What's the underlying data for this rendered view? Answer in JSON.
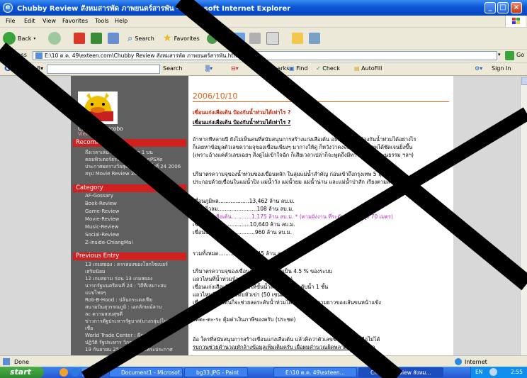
{
  "window": {
    "title": "Chubby Review สังหมสารพัด ภาพยนตร์สารพัน - Microsoft Internet Explorer",
    "controls": [
      "_",
      "□",
      "×"
    ]
  },
  "menu": [
    "File",
    "Edit",
    "View",
    "Favorites",
    "Tools",
    "Help"
  ],
  "toolbar": {
    "back": "Back",
    "search": "Search",
    "favorites": "Favorites"
  },
  "address": {
    "label": "Address",
    "value": "E:\\10 ต.ค. 49\\exteen.com\\Chubby Review สังหมสารพัด ภาพยนตร์สารพัน.htm",
    "go": "Go",
    "links": "Links"
  },
  "googlebar": {
    "logo": "Google",
    "search": "Search",
    "bookmarks": "Bookmarks",
    "find": "Find",
    "check": "Check",
    "autofill": "AutoFill",
    "signin": "Sign In"
  },
  "sidebar": {
    "profile_name": "Chubby Chocobo",
    "profile_link": "View full profile",
    "recommended_title": "Recommended",
    "recommended": [
      "ถึงเวลาเล่น Play Station 1 บน",
      "คอมพิวเตอร์ธรรมดาด้วย กับ ePSXe",
      "ประกาศผลรางวัลสุพรรณหงส์ครั้งที่ 24 2006",
      "สรุป Movie Review 2005"
    ],
    "category_title": "Category",
    "categories": [
      "AF-Gossary",
      "Book-Review",
      "Game-Review",
      "Movie-Review",
      "Music-Review",
      "Social-Review",
      "Z-Inside-ChiangMai"
    ],
    "previous_title": "Previous Entry",
    "previous": [
      "13 เกมสยอง : ดรรลองของโลกไซเบอร์",
      "เสริมนิยม",
      "12 เกมสยาม ก่อน 13 เกมสยอง",
      "นารกรัฐมนตรีคนที่ 24 : วิถีทีเหมาะสม",
      "แบบไทยๆ",
      "Rob-B-Hood : ปล้นกระเตงเฟีย",
      "สนามบินสุวรรณภูมิ : เอกลักษณ์ลาบ",
      "ละ ความสงบสุขดี",
      "ข่าวการตัฐประหารรัฐบาล(บางกลุ่ม)ไม่เคย",
      "เชื่อ",
      "World Trade Center : ผีกเงิน",
      "ปฏิวัติ รัฐประหาร วิกฤต กบฏ",
      "19 กันยายน 2549 : เมื่อทรงพระประกาศ"
    ]
  },
  "post": {
    "date": "2006/10/10",
    "title": "เขื่อนแก่งเสือเต้น ป้องกันน้ำท่วมได้เท่าไร ?",
    "subtitle": "เขื่อนแก่งเสือเต้น ป้องกันน้ำท่วมได้เท่าไร ?",
    "para1": [
      "ถ้าหากทีหลายปี ยังไม่เห็นคนที่สนับสนุนการสร้างแก่งเสือเต้น อธิบายว่ามันป้องกันน้ำท่วมได้อย่างไร",
      "ก็เลยหาข้อมูลตัวเลขความจุของเขื่อนเพียงๆ มากางให้ดู ก็หวังว่าคงจะมองเห็นภาพได้ชัดเจนยิ่งขึ้น",
      "(เพราะอ้างแค่ตัวเลขเฉยๆ สิ่งดูไม่เข้าใจฉัก ก็เสียเวลาเปล่าก็จะพูดถึงมีทาวงสังคม วัฒนธรรม ฯลฯ)"
    ],
    "para2": [
      "ปริมาตรความจุของน้ำท่วมของเขื่อนหลัก ในลุ่มแม่น้ำสำคัญ ก่อนเข้าถึงกรุงเทพ 5 ลุ่มแม่น้ำ",
      "ประกอบด้วยเขื่อนในแม่น้ำปิง แม่น้ำวัง แม่น้ำยม แม่น้ำน่าน และแม่น้ำป่าสัก เรียงตามลำดับ"
    ],
    "dams": [
      "เขื่อนภูมิพล..................13,462 ล้าน ลบ.ม.",
      "เขื่อนกิ่วลม.......................108 ล้าน ลบ.ม.",
      "เขื่อนแก่งเสือเต้น............1,175 ล้าน ลบ.ม. * (ตามผังงาน ที่ระดับสันเขื่อนสูง 70 เมตร)",
      "เขื่อนสิริกิติ์...................10,640 ล้าน ลบ.ม.",
      "เขื่อนป่าสัก......................960 ล้าน ลบ.ม."
    ],
    "total": "รวมทั้งหมด................26,345 ล้าน ลบ.ม.",
    "para3": [
      "ปริมาตรความจุของเขื่อนแก่งเสือเต้นคิดเป็น 4.5 % ของระบบ",
      "แถวไหนที่น้ำท่วมบ้านขั้นล่างเหลือ (3 เมตร)",
      "เขื่อนแก่งเสือเต้นก็จะช่วยให้ขั้นน้ำลงไปโดยมีระดับน้ำ 1 ชั้น",
      "แถวไหนที่น้ำท่วมระดับหัวเข่า (50 เซนติเมตร)",
      "เขื่อนแก่งเสือเต้นก็จะช่วยลดระดับน้ำท่วมได้เท่ากับ 1 ความยาวของเส้นขนหน้าแข้ง"
    ],
    "para4": "โคตะ-ตะ-ระ คุ้มค่าเงินภาษีของครับ (ประชด)",
    "para5": [
      "อ้อ ใครที่สนับสนุนการสร้างเขื่อนแก่งเสือเต้น แล้วคิดว่าตัวเลขข้างบนนี้เชื่อถือไม่ได้",
      "รบกวนช่วยคำนวณหักล้างข้อมูลเพิ่มเติมครับ เผื่อผมคำนวณผิดพลาดไปในบางจุด"
    ]
  },
  "status": {
    "text": "Done",
    "zone": "Internet"
  },
  "taskbar": {
    "start": "start",
    "items": [
      "Document1 - Microsof...",
      "bg33.JPG - Paint",
      "E:\\10 ต.ค. 49\\exteen...",
      "Chubby Review สังหม..."
    ],
    "lang": "EN",
    "clock": "2:55"
  },
  "colors": {
    "title_blue": "#0a55d6",
    "sidebar_red": "#d02020",
    "date_orange": "#e06010",
    "post_title_red": "#cc2200",
    "highlight_purple": "#b030c0"
  }
}
